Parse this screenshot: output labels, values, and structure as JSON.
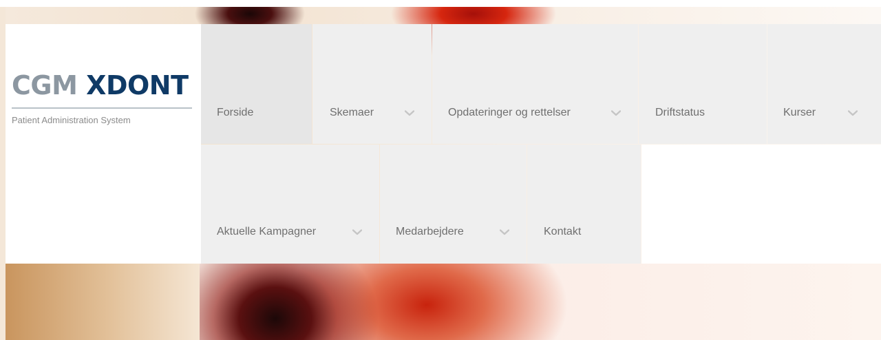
{
  "logo": {
    "brand_part1": "CGM",
    "brand_part2": "XDONT",
    "subtitle": "Patient Administration System"
  },
  "nav": {
    "row1": [
      {
        "label": "Forside",
        "has_dropdown": false,
        "active": true
      },
      {
        "label": "Skemaer",
        "has_dropdown": true
      },
      {
        "label": "Opdateringer og rettelser",
        "has_dropdown": true
      },
      {
        "label": "Driftstatus",
        "has_dropdown": false
      },
      {
        "label": "Kurser",
        "has_dropdown": true
      }
    ],
    "row2": [
      {
        "label": "Aktuelle Kampagner",
        "has_dropdown": true
      },
      {
        "label": "Medarbejdere",
        "has_dropdown": true
      },
      {
        "label": "Kontakt",
        "has_dropdown": false
      }
    ]
  },
  "colors": {
    "nav_bg": "#efefef",
    "nav_active_bg": "#e6e6e6",
    "nav_text": "#6f6f6f",
    "brand_gray": "#8c97a1",
    "brand_blue": "#0f3a66"
  }
}
